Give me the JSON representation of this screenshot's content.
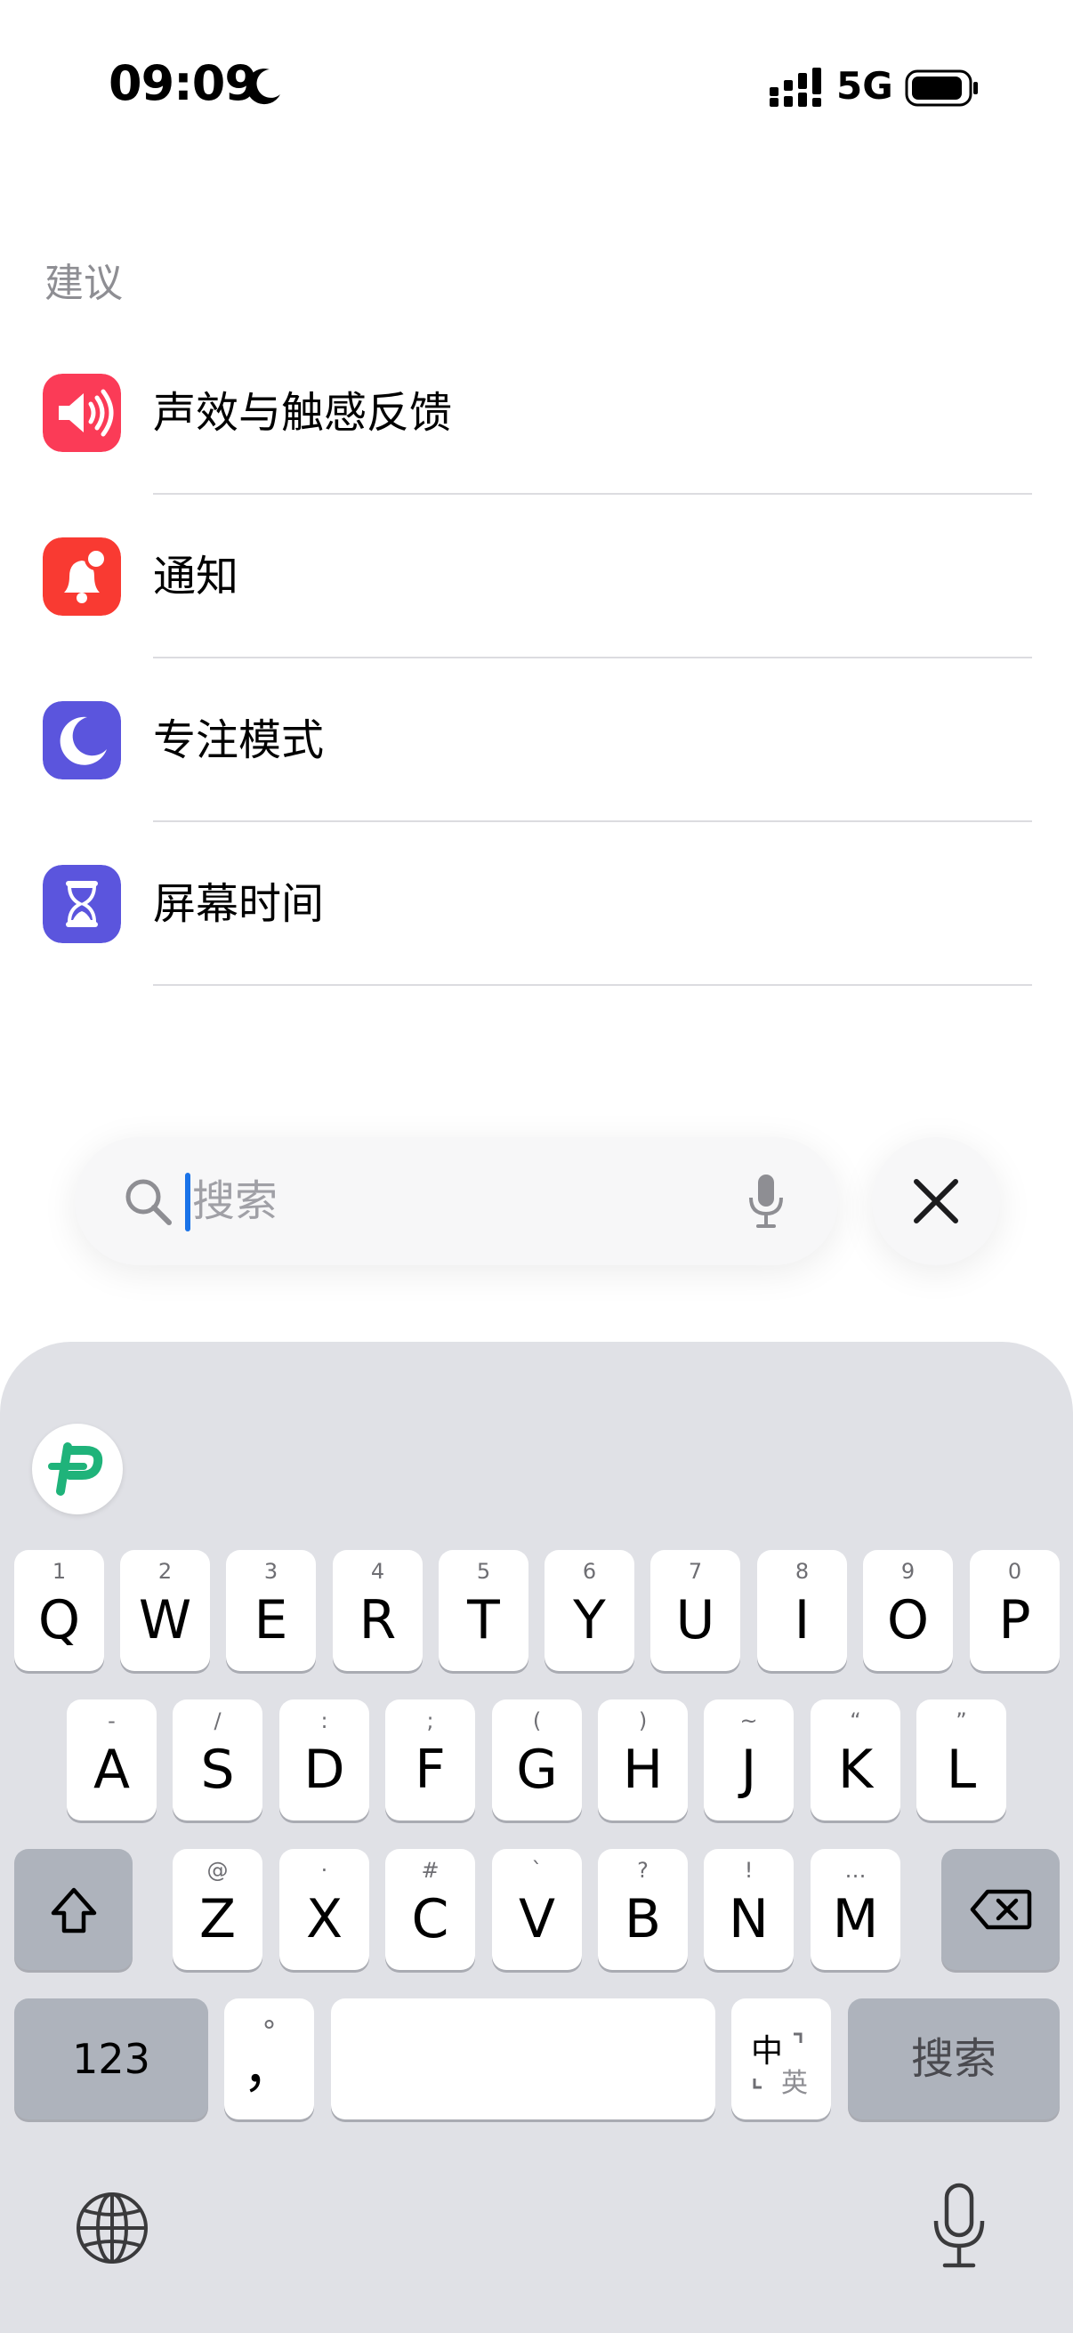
{
  "status_bar": {
    "time": "09:09",
    "network": "5G"
  },
  "suggestions": {
    "title": "建议",
    "items": [
      {
        "label": "声效与触感反馈",
        "icon": "speaker-icon",
        "color": "#fb3b57"
      },
      {
        "label": "通知",
        "icon": "notification-bell-icon",
        "color": "#f93a32"
      },
      {
        "label": "专注模式",
        "icon": "moon-icon",
        "color": "#5b55dd"
      },
      {
        "label": "屏幕时间",
        "icon": "hourglass-icon",
        "color": "#5b55dd"
      }
    ]
  },
  "search": {
    "placeholder": "搜索"
  },
  "keyboard": {
    "row1": [
      {
        "hint": "1",
        "key": "Q"
      },
      {
        "hint": "2",
        "key": "W"
      },
      {
        "hint": "3",
        "key": "E"
      },
      {
        "hint": "4",
        "key": "R"
      },
      {
        "hint": "5",
        "key": "T"
      },
      {
        "hint": "6",
        "key": "Y"
      },
      {
        "hint": "7",
        "key": "U"
      },
      {
        "hint": "8",
        "key": "I"
      },
      {
        "hint": "9",
        "key": "O"
      },
      {
        "hint": "0",
        "key": "P"
      }
    ],
    "row2": [
      {
        "hint": "-",
        "key": "A"
      },
      {
        "hint": "/",
        "key": "S"
      },
      {
        "hint": ":",
        "key": "D"
      },
      {
        "hint": ";",
        "key": "F"
      },
      {
        "hint": "(",
        "key": "G"
      },
      {
        "hint": ")",
        "key": "H"
      },
      {
        "hint": "~",
        "key": "J"
      },
      {
        "hint": "“",
        "key": "K"
      },
      {
        "hint": "”",
        "key": "L"
      }
    ],
    "row3": [
      {
        "hint": "@",
        "key": "Z"
      },
      {
        "hint": "·",
        "key": "X"
      },
      {
        "hint": "#",
        "key": "C"
      },
      {
        "hint": "`",
        "key": "V"
      },
      {
        "hint": "?",
        "key": "B"
      },
      {
        "hint": "!",
        "key": "N"
      },
      {
        "hint": "…",
        "key": "M"
      }
    ],
    "numbers_key": "123",
    "punct_hint": "°",
    "punct_key": "，",
    "lang_primary": "中",
    "lang_secondary": "英",
    "search_key": "搜索"
  }
}
